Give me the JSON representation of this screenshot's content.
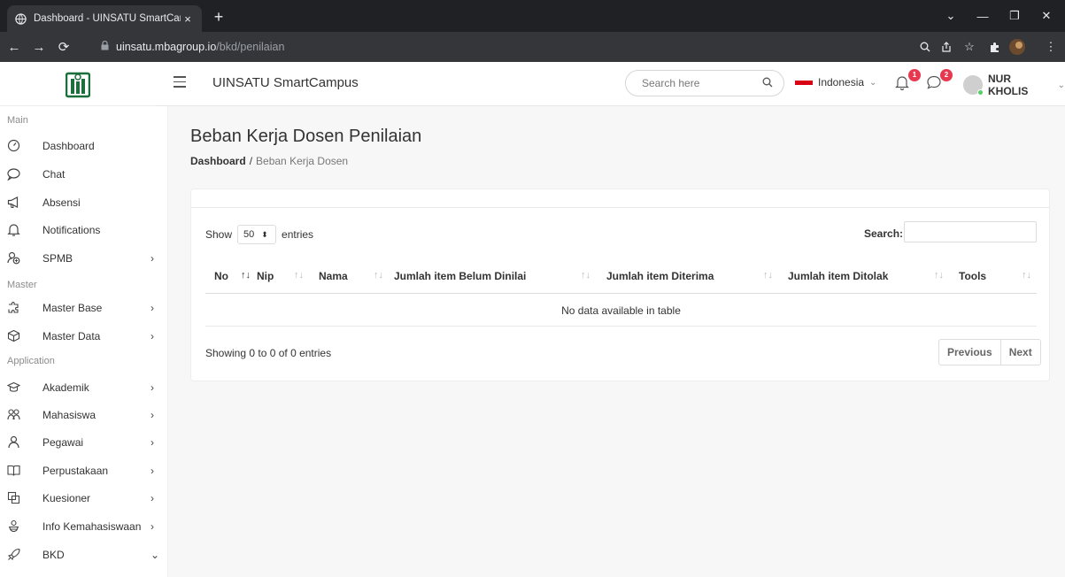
{
  "browser": {
    "tab_title": "Dashboard - UINSATU SmartCam",
    "tab_close": "×",
    "new_tab": "+",
    "url_host": "uinsatu.mbagroup.io",
    "url_path": "/bkd/penilaian"
  },
  "header": {
    "app_title": "UINSATU SmartCampus",
    "search_placeholder": "Search here",
    "language": "Indonesia",
    "notifications_count": "1",
    "messages_count": "2",
    "user_name": "NUR KHOLIS"
  },
  "sidebar": {
    "sections": {
      "main": "Main",
      "master": "Master",
      "application": "Application"
    },
    "items": [
      {
        "label": "Dashboard"
      },
      {
        "label": "Chat"
      },
      {
        "label": "Absensi"
      },
      {
        "label": "Notifications"
      },
      {
        "label": "SPMB"
      },
      {
        "label": "Master Base"
      },
      {
        "label": "Master Data"
      },
      {
        "label": "Akademik"
      },
      {
        "label": "Mahasiswa"
      },
      {
        "label": "Pegawai"
      },
      {
        "label": "Perpustakaan"
      },
      {
        "label": "Kuesioner"
      },
      {
        "label": "Info Kemahasiswaan"
      },
      {
        "label": "BKD"
      }
    ]
  },
  "page": {
    "title": "Beban Kerja Dosen Penilaian",
    "breadcrumb": {
      "root": "Dashboard",
      "separator": "/",
      "current": "Beban Kerja Dosen"
    }
  },
  "table": {
    "show_label": "Show",
    "entries_value": "50",
    "entries_label": "entries",
    "search_label": "Search:",
    "columns": [
      "No",
      "Nip",
      "Nama",
      "Jumlah item Belum Dinilai",
      "Jumlah item Diterima",
      "Jumlah item Ditolak",
      "Tools"
    ],
    "empty_message": "No data available in table",
    "info": "Showing 0 to 0 of 0 entries",
    "prev_label": "Previous",
    "next_label": "Next"
  },
  "colors": {
    "accent": "#e8384f",
    "flag_red": "#d90016",
    "online": "#55ce63"
  }
}
